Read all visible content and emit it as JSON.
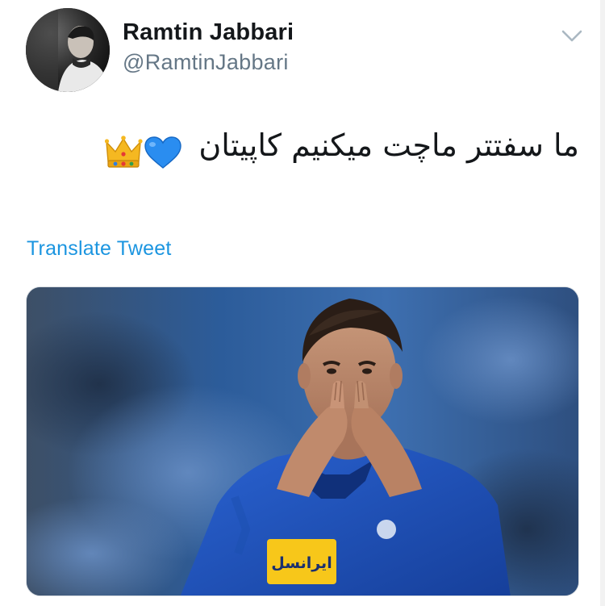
{
  "author": {
    "display_name": "Ramtin Jabbari",
    "handle": "@RamtinJabbari",
    "avatar_icon": "profile-photo"
  },
  "tweet": {
    "text": "ما سفتتر ماچت میکنیم کاپیتان",
    "emojis": [
      "blue-heart-icon",
      "crown-icon"
    ],
    "translate_label": "Translate Tweet"
  },
  "media": {
    "jersey_sponsor_text": "ايرانسل",
    "description_icon": "footballer-photo"
  },
  "colors": {
    "link": "#1b95e0",
    "name": "#14171a",
    "handle": "#657786",
    "jersey_blue": "#1f4fb8"
  }
}
